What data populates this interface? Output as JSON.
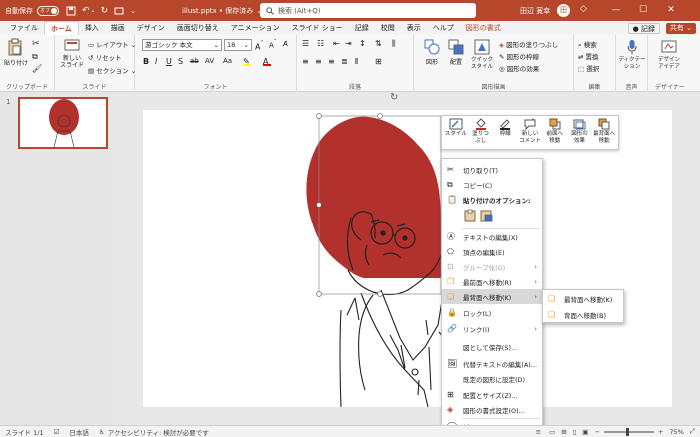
{
  "titlebar": {
    "autosave_label": "自動保存",
    "autosave_state": "オフ",
    "filename": "illust.pptx • 保存済み",
    "filename_caret": "⌄",
    "search_placeholder": "検索 (Alt+Q)",
    "user": "田辺 寛幸",
    "user_initials": "田",
    "minimize": "—",
    "maximize": "☐",
    "close": "✕"
  },
  "tabs": [
    "ファイル",
    "ホーム",
    "挿入",
    "描画",
    "デザイン",
    "画面切り替え",
    "アニメーション",
    "スライド ショー",
    "記録",
    "校閲",
    "表示",
    "ヘルプ",
    "図形の書式"
  ],
  "record_button": "● 記録",
  "share_button": "共有 ⌄",
  "ribbon": {
    "clipboard": {
      "paste": "貼り付け",
      "label": "クリップボード"
    },
    "slides": {
      "new_slide": "新しい\nスライド",
      "layout": "レイアウト",
      "reset": "リセット",
      "section": "セクション",
      "label": "スライド"
    },
    "font": {
      "font_name": "游ゴシック 本文",
      "font_size": "18",
      "label": "フォント"
    },
    "paragraph": {
      "label": "段落"
    },
    "drawing": {
      "shapes": "図形",
      "arrange": "配置",
      "quick_styles": "クイック\nスタイル",
      "shape_fill": "図形の塗りつぶし",
      "shape_outline": "図形の枠線",
      "shape_effects": "図形の効果",
      "label": "図形描画"
    },
    "editing": {
      "find": "検索",
      "replace": "置換",
      "select": "選択",
      "label": "編集"
    },
    "voice": {
      "dictate": "ディクテー\nション",
      "label": "音声"
    },
    "designer": {
      "ideas": "デザイン\nアイデア",
      "label": "デザイナー"
    }
  },
  "slide_panel": {
    "slide_number": "1"
  },
  "mini_toolbar": [
    {
      "label": "スタイル",
      "icon": "style-icon"
    },
    {
      "label": "塗りつ\nぶし",
      "icon": "fill-bucket-icon"
    },
    {
      "label": "枠線",
      "icon": "outline-pen-icon"
    },
    {
      "label": "新しい\nコメント",
      "icon": "comment-icon"
    },
    {
      "label": "前面へ\n移動",
      "icon": "bring-forward-icon"
    },
    {
      "label": "図形の\n効果",
      "icon": "shape-effects-icon"
    },
    {
      "label": "最背面へ\n移動",
      "icon": "send-to-back-icon"
    }
  ],
  "context_menu": {
    "cut": "切り取り(T)",
    "copy": "コピー(C)",
    "paste_options": "貼り付けのオプション:",
    "edit_text": "テキストの編集(X)",
    "edit_points": "頂点の編集(E)",
    "group": "グループ化(G)",
    "bring_to_front": "最前面へ移動(R)",
    "send_to_back": "最背面へ移動(K)",
    "lock": "ロック(L)",
    "link": "リンク(I)",
    "save_as_picture": "図として保存(S)...",
    "edit_alt_text": "代替テキストの編集(A)...",
    "set_default_shape": "既定の図形に設定(D)",
    "size_position": "配置とサイズ(Z)...",
    "format_shape": "図形の書式設定(O)...",
    "new_comment": "新しいコメント(M)"
  },
  "submenu": {
    "send_to_back": "最背面へ移動(K)",
    "send_backward": "背面へ移動(B)"
  },
  "statusbar": {
    "slide_info": "スライド 1/1",
    "language": "日本語",
    "accessibility": "アクセシビリティ: 検討が必要です",
    "zoom": "75%"
  },
  "colors": {
    "accent": "#b7472a",
    "shape_fill": "#b2312d"
  }
}
